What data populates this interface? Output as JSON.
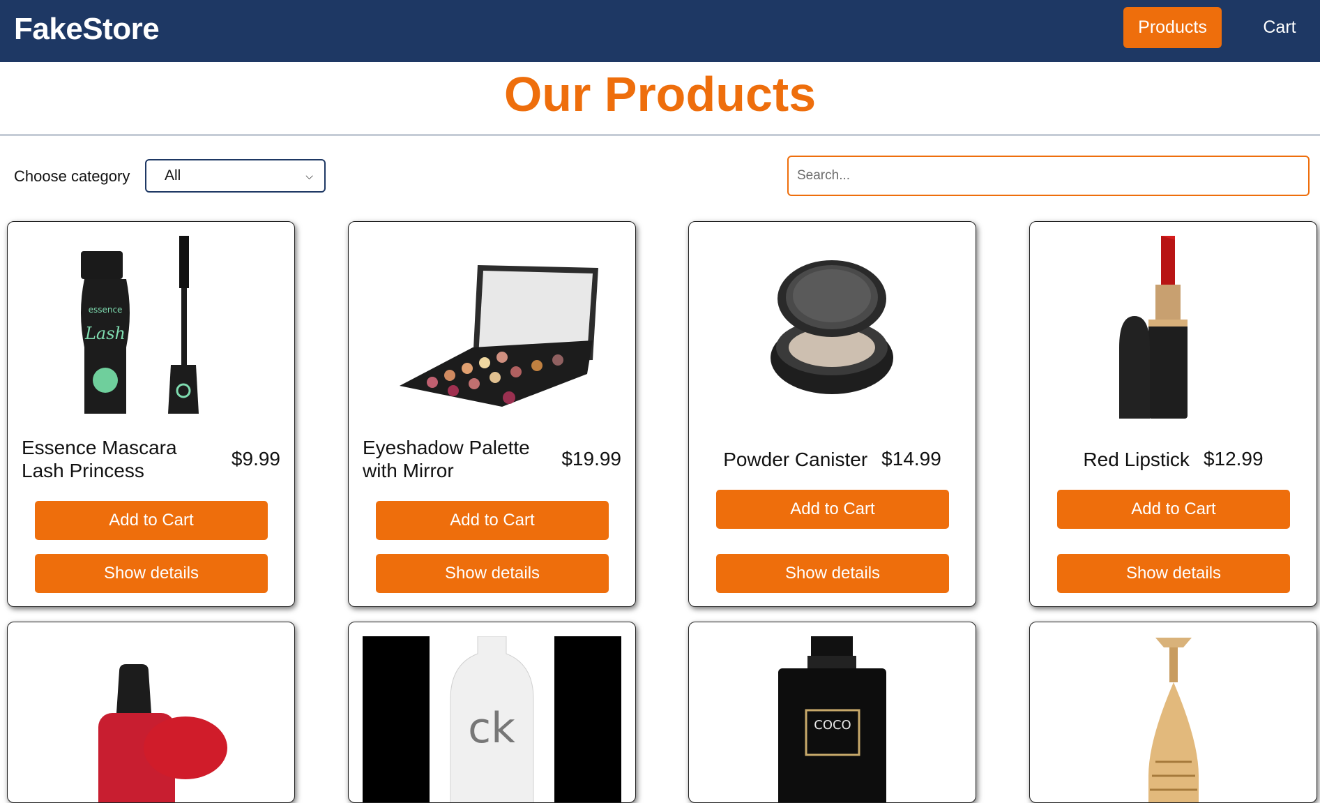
{
  "header": {
    "brand": "FakeStore",
    "nav": {
      "products": "Products",
      "cart": "Cart"
    }
  },
  "page_title": "Our Products",
  "filters": {
    "category_label": "Choose category",
    "category_selected": "All",
    "search_placeholder": "Search..."
  },
  "products": [
    {
      "name": "Essence Mascara Lash Princess",
      "price": "$9.99",
      "add_label": "Add to Cart",
      "details_label": "Show details",
      "image_icon": "mascara-image"
    },
    {
      "name": "Eyeshadow Palette with Mirror",
      "price": "$19.99",
      "add_label": "Add to Cart",
      "details_label": "Show details",
      "image_icon": "eyeshadow-palette-image"
    },
    {
      "name": "Powder Canister",
      "price": "$14.99",
      "add_label": "Add to Cart",
      "details_label": "Show details",
      "image_icon": "powder-canister-image"
    },
    {
      "name": "Red Lipstick",
      "price": "$12.99",
      "add_label": "Add to Cart",
      "details_label": "Show details",
      "image_icon": "lipstick-image"
    },
    {
      "image_icon": "nail-polish-image"
    },
    {
      "image_icon": "perfume-bottle-image",
      "image_text": "ck"
    },
    {
      "image_icon": "perfume-bottle-image",
      "image_text": "COCO"
    },
    {
      "image_icon": "perfume-bottle-image"
    }
  ],
  "colors": {
    "navbar": "#1e3864",
    "accent": "#ee6e0c"
  }
}
